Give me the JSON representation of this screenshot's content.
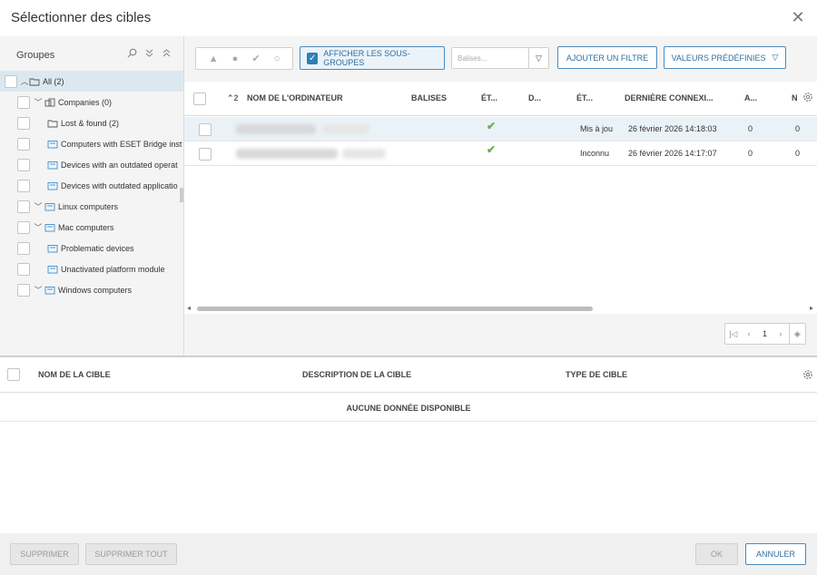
{
  "dialog": {
    "title": "Sélectionner des cibles"
  },
  "groups": {
    "title": "Groupes",
    "tree": [
      {
        "label": "All (2)",
        "selected": true
      },
      {
        "label": "Companies (0)"
      },
      {
        "label": "Lost & found (2)"
      },
      {
        "label": "Computers with ESET Bridge inst"
      },
      {
        "label": "Devices with an outdated operat"
      },
      {
        "label": "Devices with outdated applicatio"
      },
      {
        "label": "Linux computers"
      },
      {
        "label": "Mac computers"
      },
      {
        "label": "Problematic devices"
      },
      {
        "label": "Unactivated platform module"
      },
      {
        "label": "Windows computers"
      }
    ]
  },
  "toolbar": {
    "show_subgroups": "AFFICHER LES SOUS-GROUPES",
    "tags_placeholder": "Balises...",
    "add_filter": "AJOUTER UN FILTRE",
    "presets": "VALEURS PRÉDÉFINIES"
  },
  "computers": {
    "sort_indicator": "2",
    "columns": [
      "NOM DE L'ORDINATEUR",
      "BALISES",
      "ÉT...",
      "D...",
      "ÉT...",
      "DERNIÈRE CONNEXI...",
      "A...",
      "N"
    ],
    "rows": [
      {
        "status": "Mis à jou",
        "last_connection": "26 février 2026 14:18:03",
        "a": "0",
        "n": "0"
      },
      {
        "status": "Inconnu",
        "last_connection": "26 février 2026 14:17:07",
        "a": "0",
        "n": "0"
      }
    ]
  },
  "pager": {
    "page": "1"
  },
  "targets": {
    "columns": [
      "NOM DE LA CIBLE",
      "DESCRIPTION DE LA CIBLE",
      "TYPE DE CIBLE"
    ],
    "empty": "AUCUNE DONNÉE DISPONIBLE"
  },
  "footer": {
    "delete": "SUPPRIMER",
    "delete_all": "SUPPRIMER TOUT",
    "ok": "OK",
    "cancel": "ANNULER"
  }
}
